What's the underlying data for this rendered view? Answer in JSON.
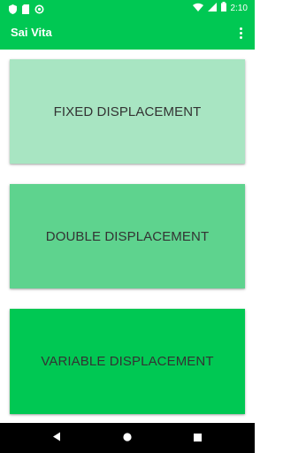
{
  "status_bar": {
    "time": "2:10",
    "icons": [
      "shield-icon",
      "sim-card-icon",
      "sync-icon",
      "wifi-icon",
      "signal-icon",
      "battery-icon"
    ]
  },
  "app_bar": {
    "title": "Sai Vita",
    "menu_icon": "more-vert-icon"
  },
  "cards": [
    {
      "label": "FIXED DISPLACEMENT",
      "color": "#a8e5c2"
    },
    {
      "label": "DOUBLE DISPLACEMENT",
      "color": "#5ed38e"
    },
    {
      "label": "VARIABLE DISPLACEMENT",
      "color": "#00c853"
    }
  ],
  "nav_bar": {
    "buttons": [
      "back-icon",
      "home-icon",
      "recents-icon"
    ]
  },
  "colors": {
    "primary": "#00c853",
    "text": "#333333"
  }
}
